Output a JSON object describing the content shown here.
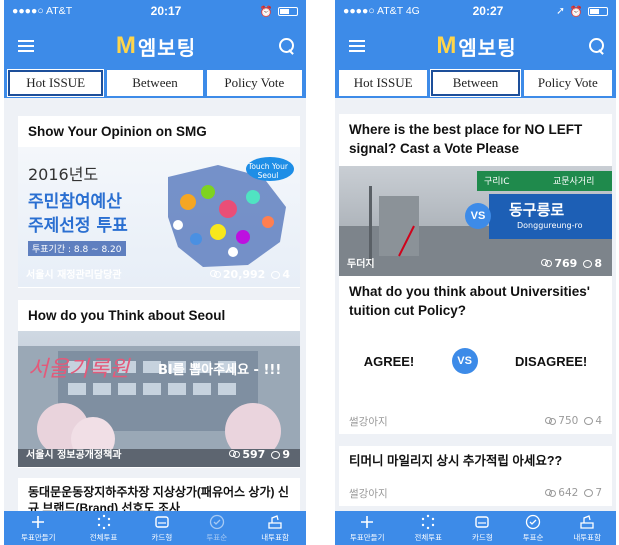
{
  "left": {
    "status": {
      "carrier": "●●●●○ AT&T",
      "time": "20:17"
    },
    "logo": {
      "m": "M",
      "text": "엠보팅"
    },
    "tabs": [
      {
        "label": "Hot ISSUE",
        "active": true
      },
      {
        "label": "Between",
        "active": false
      },
      {
        "label": "Policy Vote",
        "active": false
      }
    ],
    "cards": [
      {
        "title": "Show Your Opinion on SMG",
        "banner": {
          "year": "2016년도",
          "line1": "주민참여예산",
          "line2": "주제선정 투표",
          "period": "투표기간 : 8.8 ~ 8.20",
          "badge": "Touch Your Seoul"
        },
        "source": "서울시 재정관리담당관",
        "participants": "20,992",
        "comments": "4"
      },
      {
        "title": "How do you Think about Seoul",
        "banner": {
          "script": "서울기록원",
          "bi": "BI를 뽑아주세요 - !!!"
        },
        "source": "서울시 정보공개정책과",
        "participants": "597",
        "comments": "9"
      },
      {
        "title": "동대문운동장지하주차장 지상상가(패유어스 상가) 신규 브랜드(Brand) 선호도 조사"
      }
    ]
  },
  "right": {
    "status": {
      "carrier": "●●●●○ AT&T  4G",
      "time": "20:27"
    },
    "logo": {
      "m": "M",
      "text": "엠보팅"
    },
    "tabs": [
      {
        "label": "Hot ISSUE",
        "active": false
      },
      {
        "label": "Between",
        "active": true
      },
      {
        "label": "Policy Vote",
        "active": false
      }
    ],
    "cards": [
      {
        "title": "Where is the best place for NO LEFT signal? Cast a Vote Please",
        "sign": {
          "top_left": "구리IC",
          "top_right": "교문사거리",
          "vs": "VS",
          "road": "동구릉로",
          "road_en": "Donggureung-ro"
        },
        "source": "두더지",
        "participants": "769",
        "comments": "8"
      },
      {
        "title": "What do you think about Universities' tuition cut Policy?",
        "agree": "AGREE!",
        "vs": "VS",
        "disagree": "DISAGREE!",
        "source": "썰강아지",
        "participants": "750",
        "comments": "4"
      },
      {
        "title": "티머니 마일리지 상시 추가적립 아세요??",
        "source": "썰강아지",
        "participants": "642",
        "comments": "7"
      }
    ]
  },
  "nav": [
    {
      "label": "투표만들기",
      "icon": "plus-icon"
    },
    {
      "label": "전체투표",
      "icon": "dots-circle-icon"
    },
    {
      "label": "카드형",
      "icon": "card-icon"
    },
    {
      "label": "투표순",
      "icon": "check-circle-icon"
    },
    {
      "label": "내투표함",
      "icon": "ballot-box-icon"
    }
  ],
  "colors": {
    "primary": "#3d8be8",
    "logo_m": "#ffd54a"
  }
}
